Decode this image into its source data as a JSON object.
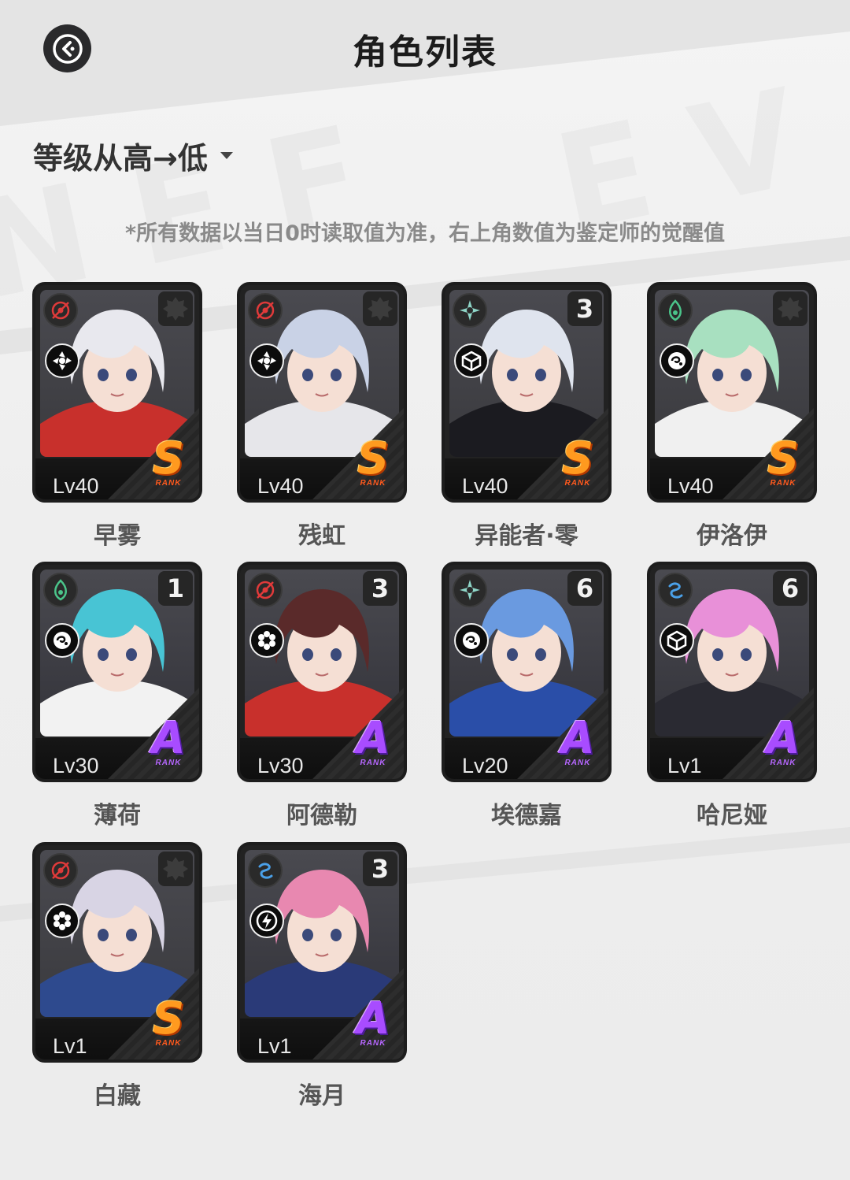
{
  "header": {
    "title": "角色列表"
  },
  "sort": {
    "label": "等级从高→低"
  },
  "note": "*所有数据以当日0时读取值为准，右上角数值为鉴定师的觉醒值",
  "characters": [
    {
      "name": "早雾",
      "level": "Lv40",
      "rank": "S",
      "rank_sub": "RANK",
      "awakening": "",
      "element": "fire",
      "role": "vortex",
      "element_color": "#e03a3a",
      "hair": "#e8e8ee",
      "cloth": "#c8302c"
    },
    {
      "name": "残虹",
      "level": "Lv40",
      "rank": "S",
      "rank_sub": "RANK",
      "awakening": "",
      "element": "fire",
      "role": "vortex",
      "element_color": "#e03a3a",
      "hair": "#c9d2e6",
      "cloth": "#e6e6ea"
    },
    {
      "name": "异能者·零",
      "level": "Lv40",
      "rank": "S",
      "rank_sub": "RANK",
      "awakening": "3",
      "element": "light",
      "role": "cube",
      "element_color": "#8fd6c8",
      "hair": "#dfe4ee",
      "cloth": "#1b1b20"
    },
    {
      "name": "伊洛伊",
      "level": "Lv40",
      "rank": "S",
      "rank_sub": "RANK",
      "awakening": "",
      "element": "nature",
      "role": "swirl",
      "element_color": "#4bc48a",
      "hair": "#a8e0c0",
      "cloth": "#f0f0f0"
    },
    {
      "name": "薄荷",
      "level": "Lv30",
      "rank": "A",
      "rank_sub": "RANK",
      "awakening": "1",
      "element": "nature",
      "role": "swirl",
      "element_color": "#4bc48a",
      "hair": "#48c4d4",
      "cloth": "#f2f2f2"
    },
    {
      "name": "阿德勒",
      "level": "Lv30",
      "rank": "A",
      "rank_sub": "RANK",
      "awakening": "3",
      "element": "fire",
      "role": "flower",
      "element_color": "#e03a3a",
      "hair": "#5a2a2a",
      "cloth": "#c8302c"
    },
    {
      "name": "埃德嘉",
      "level": "Lv20",
      "rank": "A",
      "rank_sub": "RANK",
      "awakening": "6",
      "element": "light",
      "role": "swirl",
      "element_color": "#8fd6c8",
      "hair": "#6a9ae0",
      "cloth": "#2a4ea8"
    },
    {
      "name": "哈尼娅",
      "level": "Lv1",
      "rank": "A",
      "rank_sub": "RANK",
      "awakening": "6",
      "element": "water",
      "role": "cube",
      "element_color": "#4aa0e8",
      "hair": "#e890d8",
      "cloth": "#2a2a32"
    },
    {
      "name": "白藏",
      "level": "Lv1",
      "rank": "S",
      "rank_sub": "RANK",
      "awakening": "",
      "element": "fire",
      "role": "flower",
      "element_color": "#e03a3a",
      "hair": "#d8d4e4",
      "cloth": "#2e4a8e"
    },
    {
      "name": "海月",
      "level": "Lv1",
      "rank": "A",
      "rank_sub": "RANK",
      "awakening": "3",
      "element": "water",
      "role": "bolt",
      "element_color": "#4aa0e8",
      "hair": "#e888b0",
      "cloth": "#2a3a78"
    }
  ]
}
